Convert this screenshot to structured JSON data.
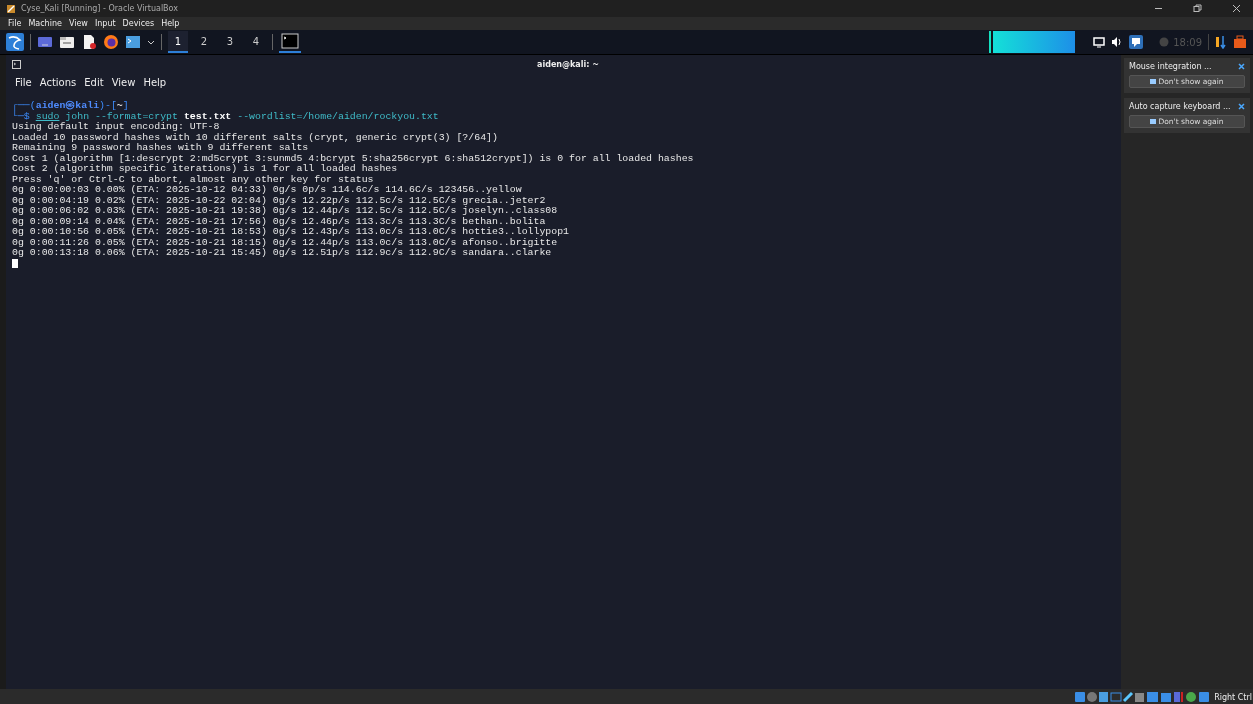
{
  "window": {
    "title": "Cyse_Kali [Running] - Oracle VirtualBox"
  },
  "menu": [
    "File",
    "Machine",
    "View",
    "Input",
    "Devices",
    "Help"
  ],
  "panel": {
    "workspaces": [
      {
        "label": "1",
        "selected": true
      },
      {
        "label": "2",
        "selected": false
      },
      {
        "label": "3",
        "selected": false
      },
      {
        "label": "4",
        "selected": false
      }
    ],
    "clock": "18:09"
  },
  "terminal": {
    "title": "aiden@kali: ~",
    "menu": [
      "File",
      "Actions",
      "Edit",
      "View",
      "Help"
    ],
    "prompt": [
      {
        "text": "┌──(",
        "kind": "frame"
      },
      {
        "text": "aiden㉿kali",
        "kind": "user"
      },
      {
        "text": ")-[",
        "kind": "frame"
      },
      {
        "text": "~",
        "kind": "dir"
      },
      {
        "text": "]",
        "kind": "frame"
      }
    ],
    "command": [
      {
        "text": "└─$ ",
        "kind": "frame"
      },
      {
        "text": "sudo",
        "kind": "command"
      },
      {
        "text": " john --format=crypt ",
        "kind": "option"
      },
      {
        "text": "test.txt",
        "kind": "file"
      },
      {
        "text": " --wordlist=/home/aiden/rockyou.txt",
        "kind": "option"
      }
    ],
    "output": [
      "Using default input encoding: UTF-8",
      "Loaded 10 password hashes with 10 different salts (crypt, generic crypt(3) [?/64])",
      "Remaining 9 password hashes with 9 different salts",
      "Cost 1 (algorithm [1:descrypt 2:md5crypt 3:sunmd5 4:bcrypt 5:sha256crypt 6:sha512crypt]) is 0 for all loaded hashes",
      "Cost 2 (algorithm specific iterations) is 1 for all loaded hashes",
      "Press 'q' or Ctrl-C to abort, almost any other key for status",
      "0g 0:00:00:03 0.00% (ETA: 2025-10-12 04:33) 0g/s 0p/s 114.6c/s 114.6C/s 123456..yellow",
      "0g 0:00:04:19 0.02% (ETA: 2025-10-22 02:04) 0g/s 12.22p/s 112.5c/s 112.5C/s grecia..jeter2",
      "0g 0:00:06:02 0.03% (ETA: 2025-10-21 19:38) 0g/s 12.44p/s 112.5c/s 112.5C/s joselyn..class08",
      "0g 0:00:09:14 0.04% (ETA: 2025-10-21 17:56) 0g/s 12.46p/s 113.3c/s 113.3C/s bethan..bolita",
      "0g 0:00:10:56 0.05% (ETA: 2025-10-21 18:53) 0g/s 12.43p/s 113.0c/s 113.0C/s hottie3..lollypop1",
      "0g 0:00:11:26 0.05% (ETA: 2025-10-21 18:15) 0g/s 12.44p/s 113.0c/s 113.0C/s afonso..brigitte",
      "0g 0:00:13:18 0.06% (ETA: 2025-10-21 15:45) 0g/s 12.51p/s 112.9c/s 112.9C/s sandara..clarke"
    ]
  },
  "notifications": [
    {
      "title": "Mouse integration ...",
      "button": "Don't show again"
    },
    {
      "title": "Auto capture keyboard ...",
      "button": "Don't show again"
    }
  ],
  "status_bar": {
    "host_key": "Right Ctrl"
  }
}
